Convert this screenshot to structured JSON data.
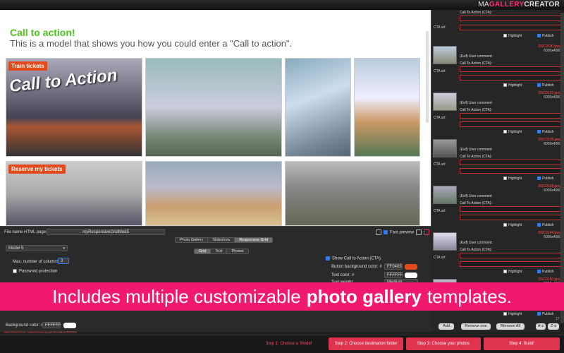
{
  "brand": {
    "part1": "MA",
    "part2": "GALLERY",
    "part3": "CREATOR"
  },
  "preview": {
    "cta_title": "Call to action!",
    "cta_subtitle": "This is a model that shows you how you could enter a \"Call to action\".",
    "photos": [
      {
        "label": "Train tickets",
        "overlay": "Call to Action"
      },
      {
        "label": "",
        "overlay": ""
      },
      {
        "label": "",
        "overlay": ""
      },
      {
        "label": "",
        "overlay": ""
      },
      {
        "label": "Reserve my tickets",
        "overlay": ""
      },
      {
        "label": "",
        "overlay": ""
      },
      {
        "label": "",
        "overlay": ""
      }
    ]
  },
  "right_panel": {
    "labels": {
      "cta": "Call To Action (CTA):",
      "cta_url": "CTA url:",
      "user_comment": "(Exif) User comment:",
      "highlight": "Highlight",
      "publish": "Publish"
    },
    "photos": [
      {
        "file": "DSC0130.jpeg",
        "size": "6000x4000"
      },
      {
        "file": "DSC0133.jpeg",
        "size": "6000x4000"
      },
      {
        "file": "DSC0135.jpeg",
        "size": "6000x4000"
      },
      {
        "file": "DSC0138.jpeg",
        "size": "6000x4000"
      },
      {
        "file": "DSC0144.jpeg",
        "size": "6000x4000"
      },
      {
        "file": "DSC0150.jpeg",
        "size": "6000x4000"
      }
    ],
    "count": "17",
    "buttons": {
      "add": "Add",
      "remove_one": "Remove one",
      "remove_all": "Remove All",
      "sort_az": "A-z",
      "sort_za": "Z-a"
    }
  },
  "settings": {
    "filename_label": "File name HTML page:",
    "filename_value": "myResponsiveGridMod5",
    "fast_preview": "Fast preview",
    "mode_tabs": [
      {
        "label": "Photo Gallery",
        "active": false
      },
      {
        "label": "Slideshow",
        "active": false
      },
      {
        "label": "Responsive Grid",
        "active": true
      }
    ],
    "model_value": "Model 5",
    "sub_tabs": [
      {
        "label": "Grid",
        "active": true
      },
      {
        "label": "Text",
        "active": false
      },
      {
        "label": "Photos",
        "active": false
      }
    ],
    "max_columns_label": "Max. number of columns:",
    "max_columns_value": "3",
    "password_label": "Password protection",
    "show_cta_label": "Show Call to Action (CTA):",
    "button_bg_label": "Button background color: #",
    "button_bg_value": "FF0405",
    "text_color_label": "Text color: #",
    "text_color_value": "FFFFFF",
    "text_weight_label": "Text weight:",
    "text_weight_value": "Medium",
    "bg_color_label": "Background color: #",
    "bg_color_value": "FFFFFF",
    "destination": "DESTINATION: /Users/macpaysan/Desktop/DEMO/"
  },
  "banner": {
    "before": "Includes multiple customizable",
    "bold": "photo gallery",
    "after": "templates."
  },
  "steps": [
    "Step 1: Choose a 'Model'",
    "Step 2: Choose destination folder",
    "Step 3: Choose your photos",
    "Step 4: Build!"
  ],
  "colors": {
    "accent_pink": "#f0196e",
    "cta_green": "#4fc21f",
    "cta_orange": "#e04a1c",
    "step_pink": "#e0334f"
  }
}
